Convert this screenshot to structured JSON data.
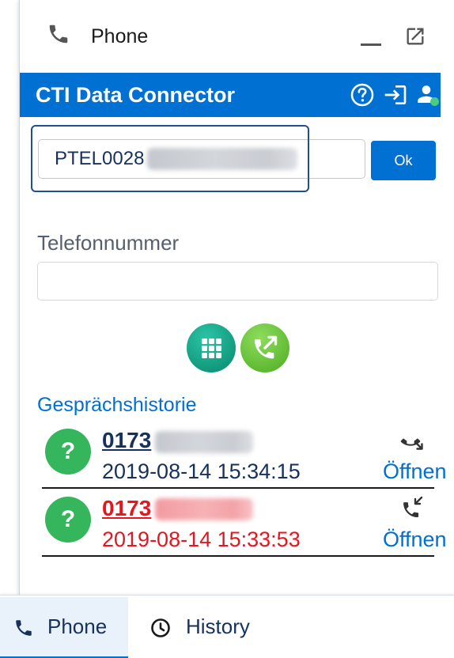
{
  "panel": {
    "title": "Phone",
    "title_icon": "phone-icon",
    "controls": {
      "minimize_icon": "minimize-icon",
      "popout_icon": "popout-icon"
    }
  },
  "header": {
    "title": "CTI Data Connector",
    "color": "#0070d2",
    "icons": {
      "help": "help-icon",
      "login": "login-icon",
      "user": "user-status-icon"
    },
    "user_status_color": "#4bca81"
  },
  "agent_id": {
    "value": "PTEL0028",
    "submit_label": "Ok"
  },
  "phone_number": {
    "label": "Telefonnummer",
    "value": ""
  },
  "actions": {
    "dialpad_icon": "dialpad-icon",
    "call_icon": "outbound-call-icon"
  },
  "history": {
    "title": "Gesprächshistorie",
    "items": [
      {
        "avatar_text": "?",
        "number": "0173",
        "datetime": "2019-08-14 15:34:15",
        "direction_icon": "outgoing-call-icon",
        "action_label": "Öffnen",
        "text_color": "#16325c"
      },
      {
        "avatar_text": "?",
        "number": "0173",
        "datetime": "2019-08-14 15:33:53",
        "direction_icon": "incoming-call-icon",
        "action_label": "Öffnen",
        "text_color": "#e8141e"
      }
    ]
  },
  "utility_bar": {
    "tabs": [
      {
        "label": "Phone",
        "icon": "phone-icon",
        "selected": true
      },
      {
        "label": "History",
        "icon": "clock-icon",
        "selected": false
      }
    ],
    "selected_color": "#0070d2"
  },
  "colors": {
    "accent": "#0070d2",
    "avatar": "#36b65c",
    "primary_text": "#16325c",
    "missed": "#e8141e"
  }
}
